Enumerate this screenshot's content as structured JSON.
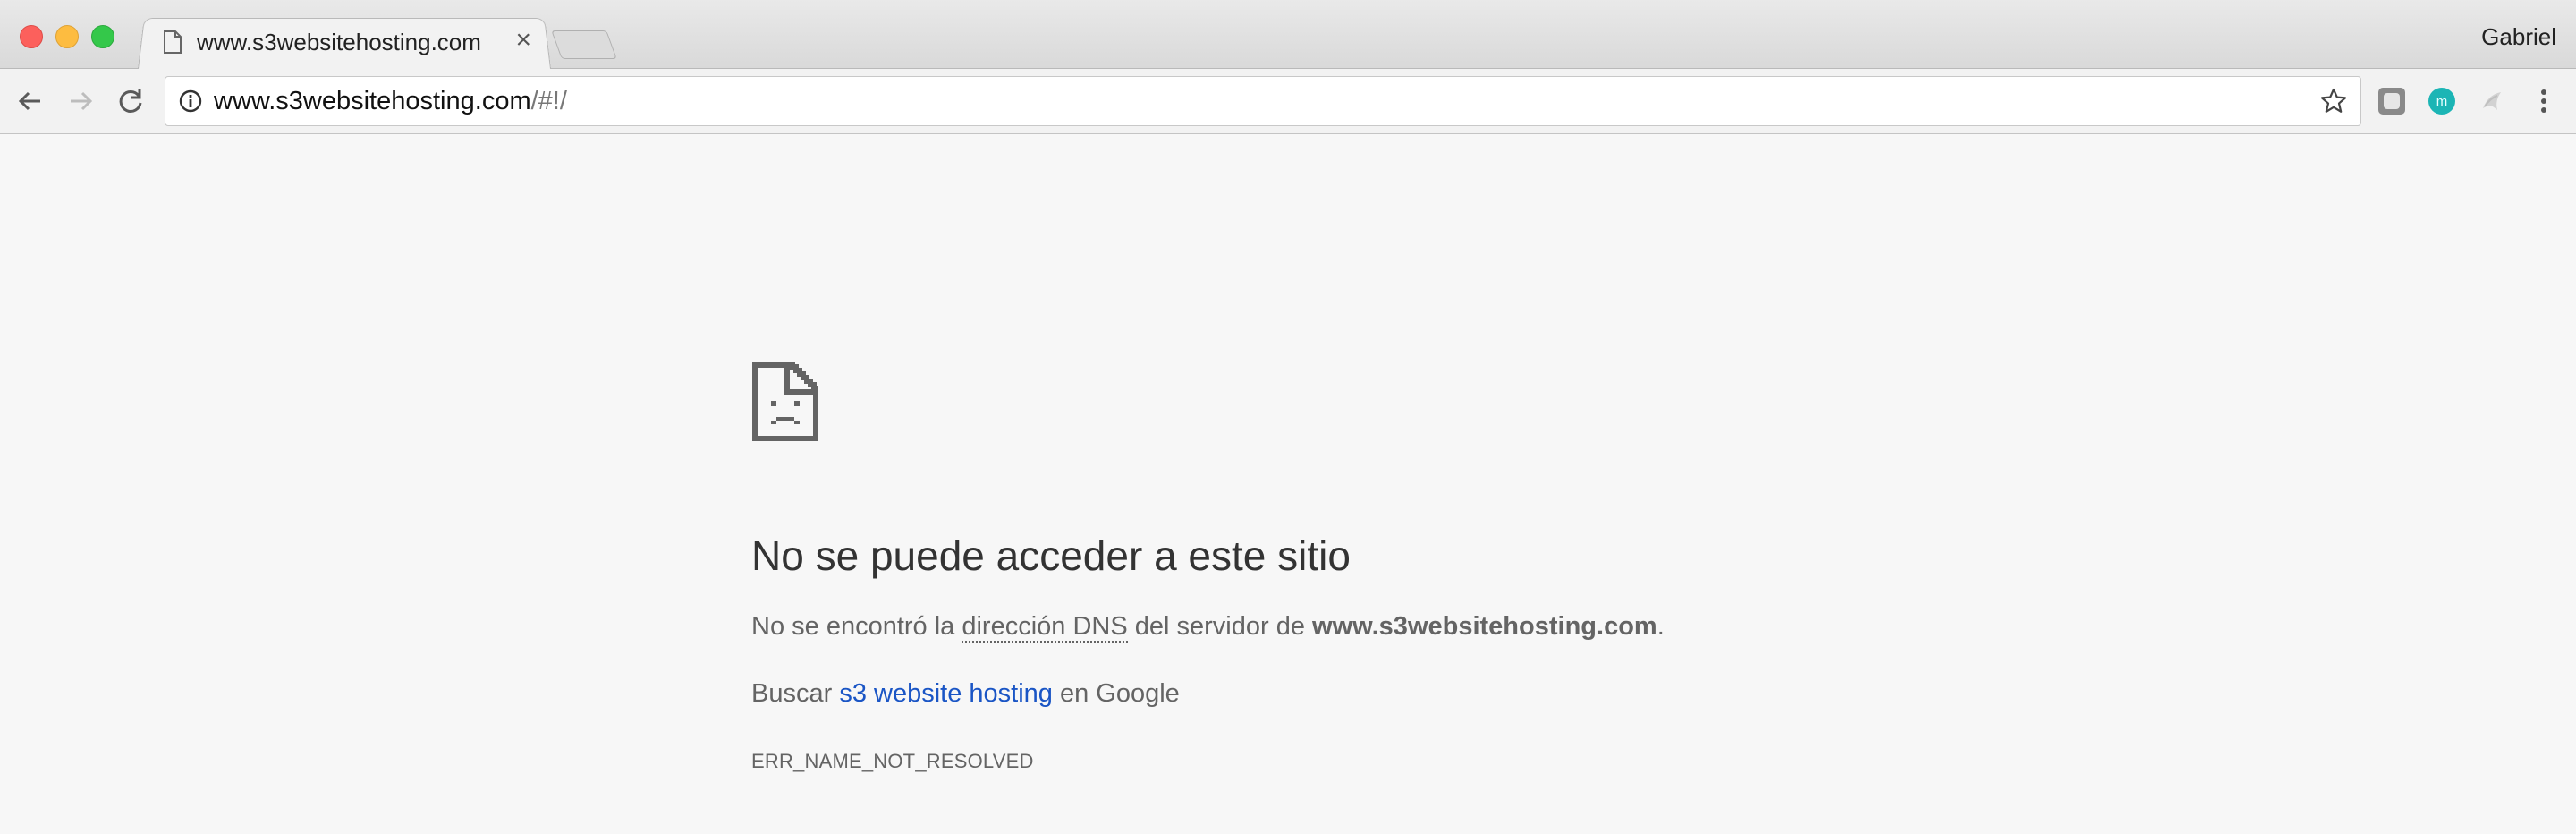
{
  "window": {
    "profile_name": "Gabriel"
  },
  "tab": {
    "title": "www.s3websitehosting.com",
    "close_label": "×",
    "favicon": "document-icon"
  },
  "toolbar": {
    "url_host": "www.s3websitehosting.com",
    "url_path": "/#!/",
    "icons": [
      "back-arrow-icon",
      "forward-arrow-icon",
      "reload-icon",
      "info-icon",
      "star-icon",
      "extension-icon",
      "menu-icon"
    ]
  },
  "error_page": {
    "title": "No se puede acceder a este sitio",
    "desc_prefix": "No se encontró la ",
    "desc_term": "dirección DNS",
    "desc_middle": " del servidor de ",
    "desc_host": "www.s3websitehosting.com",
    "desc_suffix": ".",
    "search_prefix": "Buscar ",
    "search_link": "s3 website hosting",
    "search_suffix": " en Google",
    "error_code": "ERR_NAME_NOT_RESOLVED"
  },
  "colors": {
    "link": "#1a55c5",
    "page_bg": "#f7f7f7",
    "extension_teal": "#1cb5b5"
  }
}
